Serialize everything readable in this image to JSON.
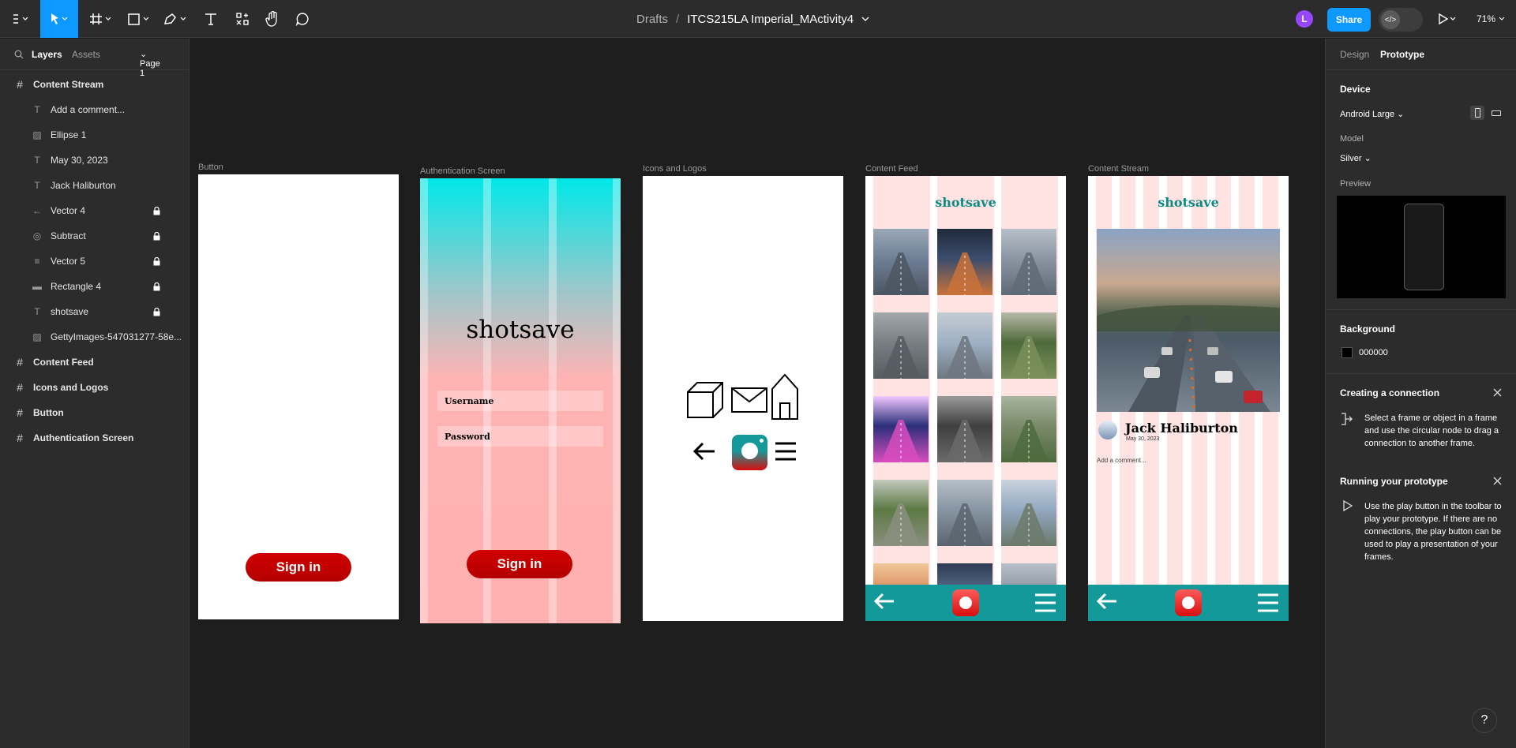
{
  "topbar": {
    "breadcrumb_root": "Drafts",
    "breadcrumb_sep": "/",
    "file_name": "ITCS215LA Imperial_MActivity4",
    "avatar_initial": "L",
    "share_label": "Share",
    "zoom": "71%",
    "icons": [
      "figma-menu-icon",
      "move-tool-icon",
      "frame-tool-icon",
      "shape-tool-icon",
      "pen-tool-icon",
      "text-tool-icon",
      "resources-icon",
      "hand-tool-icon",
      "comment-tool-icon",
      "dev-mode-icon",
      "play-icon"
    ]
  },
  "left_panel": {
    "tab_layers": "Layers",
    "tab_assets": "Assets",
    "page_selector": "Page 1",
    "layers": [
      {
        "label": "Content Stream",
        "kind": "frame",
        "icon": "frame-icon"
      },
      {
        "label": "Add a comment...",
        "kind": "child",
        "icon": "text-icon"
      },
      {
        "label": "Ellipse 1",
        "kind": "child",
        "icon": "image-icon"
      },
      {
        "label": "May 30, 2023",
        "kind": "child",
        "icon": "text-icon"
      },
      {
        "label": "Jack Haliburton",
        "kind": "child",
        "icon": "text-icon"
      },
      {
        "label": "Vector 4",
        "kind": "child",
        "icon": "arrow-icon",
        "locked": true
      },
      {
        "label": "Subtract",
        "kind": "child",
        "icon": "subtract-icon",
        "locked": true
      },
      {
        "label": "Vector 5",
        "kind": "child",
        "icon": "menu-icon",
        "locked": true
      },
      {
        "label": "Rectangle 4",
        "kind": "child",
        "icon": "rectangle-icon",
        "locked": true
      },
      {
        "label": "shotsave",
        "kind": "child",
        "icon": "text-icon",
        "locked": true
      },
      {
        "label": "GettyImages-547031277-58e...",
        "kind": "child",
        "icon": "image-icon"
      },
      {
        "label": "Content Feed",
        "kind": "frame",
        "icon": "frame-icon"
      },
      {
        "label": "Icons and Logos",
        "kind": "frame",
        "icon": "frame-icon"
      },
      {
        "label": "Button",
        "kind": "frame",
        "icon": "frame-icon"
      },
      {
        "label": "Authentication Screen",
        "kind": "frame",
        "icon": "frame-icon"
      }
    ]
  },
  "right_panel": {
    "tab_design": "Design",
    "tab_prototype": "Prototype",
    "device_heading": "Device",
    "device_value": "Android Large",
    "model_label": "Model",
    "model_value": "Silver",
    "preview_label": "Preview",
    "background_heading": "Background",
    "background_value": "000000",
    "connection_heading": "Creating a connection",
    "connection_text": "Select a frame or object in a frame and use the circular node to drag a connection to another frame.",
    "running_heading": "Running your prototype",
    "running_text": "Use the play button in the toolbar to play your prototype. If there are no connections, the play button can be used to play a presentation of your frames.",
    "help": "?"
  },
  "canvas": {
    "frames": {
      "button": {
        "label": "Button",
        "signin": "Sign in"
      },
      "auth": {
        "label": "Authentication Screen",
        "title": "shotsave",
        "username": "Username",
        "password": "Password",
        "signin": "Sign in"
      },
      "icons": {
        "label": "Icons and Logos"
      },
      "feed": {
        "label": "Content Feed",
        "brand": "shotsave"
      },
      "stream": {
        "label": "Content Stream",
        "brand": "shotsave",
        "name": "Jack Haliburton",
        "date": "May 30, 2023",
        "comment": "Add a comment..."
      }
    }
  },
  "colors": {
    "accent": "#0d99ff",
    "brand_teal": "#14999a",
    "signin_red": "#c40000",
    "auth_top": "#00e5e5",
    "auth_bottom": "#ffb0b0"
  }
}
